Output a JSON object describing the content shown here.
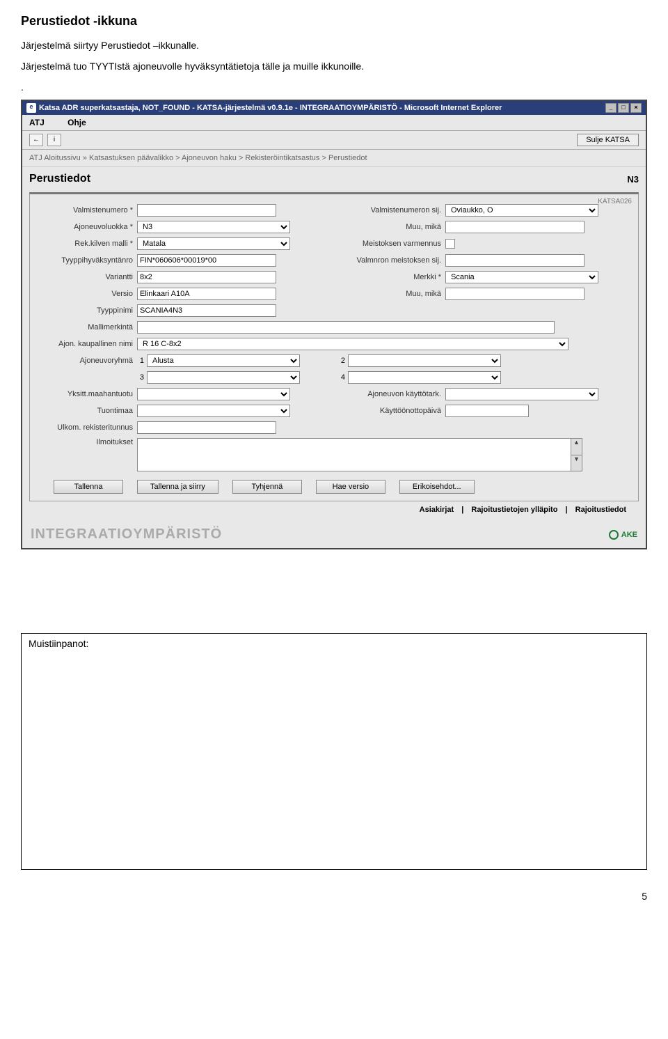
{
  "doc": {
    "heading": "Perustiedot -ikkuna",
    "intro1": "Järjestelmä siirtyy Perustiedot –ikkunalle.",
    "intro2": "Järjestelmä tuo TYYTIstä ajoneuvolle hyväksyntätietoja tälle ja muille ikkunoille.",
    "dot": ".",
    "notes_label": "Muistiinpanot:",
    "page_number": "5"
  },
  "window": {
    "title": "Katsa ADR superkatsastaja, NOT_FOUND - KATSA-järjestelmä v0.9.1e - INTEGRAATIOYMPÄRISTÖ - Microsoft Internet Explorer",
    "menu": {
      "atj": "ATJ",
      "ohje": "Ohje"
    },
    "sulje": "Sulje KATSA",
    "breadcrumb": "ATJ Aloitussivu » Katsastuksen päävalikko > Ajoneuvon haku > Rekisteröintikatsastus > Perustiedot",
    "page_title": "Perustiedot",
    "page_class": "N3",
    "katsa_code": "KATSA026",
    "env": "INTEGRAATIOYMPÄRISTÖ",
    "ake": "AKE"
  },
  "form": {
    "labels": {
      "valmistenumero": "Valmistenumero *",
      "valmistenumeron_sij": "Valmistenumeron sij.",
      "ajoneuvoluokka": "Ajoneuvoluokka *",
      "muu_mika_l": "Muu, mikä",
      "rekkilven_malli": "Rek.kilven malli *",
      "meistoksen_varmennus": "Meistoksen varmennus",
      "tyyppihyvaksyntanro": "Tyyppihyväksyntänro",
      "valmnron_meist_sij": "Valmnron meistoksen sij.",
      "variantti": "Variantti",
      "merkki": "Merkki *",
      "versio": "Versio",
      "muu_mika_r": "Muu, mikä",
      "tyyppinimi": "Tyyppinimi",
      "mallimerkinta": "Mallimerkintä",
      "ajon_kaup_nimi": "Ajon. kaupallinen nimi",
      "ajoneuvoryhma": "Ajoneuvoryhmä",
      "yksitt_maahantuotu": "Yksitt.maahantuotu",
      "ajoneuvon_kayttotark": "Ajoneuvon käyttötark.",
      "tuontimaa": "Tuontimaa",
      "kayttoonottopaiva": "Käyttöönottopäivä",
      "ulkom_rekisteritunnus": "Ulkom. rekisteritunnus",
      "ilmoitukset": "Ilmoitukset"
    },
    "values": {
      "valmistenumero": "",
      "valmistenumeron_sij": "Oviaukko, O",
      "ajoneuvoluokka": "N3",
      "muu_mika_l": "",
      "rekkilven_malli": "Matala",
      "tyyppihyvaksyntanro": "FIN*060606*00019*00",
      "valmnron_meist_sij": "",
      "variantti": "8x2",
      "merkki": "Scania",
      "versio": "Elinkaari A10A",
      "muu_mika_r": "",
      "tyyppinimi": "SCANIA4N3",
      "mallimerkinta": "",
      "ajon_kaup_nimi": "R 16 C-8x2",
      "ajoneuvoryhma1": "Alusta",
      "ajoneuvoryhma2": "",
      "ajoneuvoryhma3": "",
      "ajoneuvoryhma4": "",
      "yksitt_maahantuotu": "",
      "ajoneuvon_kayttotark": "",
      "tuontimaa": "",
      "kayttoonottopaiva": "",
      "ulkom_rekisteritunnus": "",
      "ilmoitukset": ""
    },
    "nums": {
      "n1": "1",
      "n2": "2",
      "n3": "3",
      "n4": "4"
    },
    "buttons": {
      "tallenna": "Tallenna",
      "tallenna_ja_siirry": "Tallenna ja siirry",
      "tyhjenna": "Tyhjennä",
      "hae_versio": "Hae versio",
      "erikoisehdot": "Erikoisehdot..."
    },
    "links": {
      "asiakirjat": "Asiakirjat",
      "rajoitustietojen_yllapito": "Rajoitustietojen ylläpito",
      "rajoitustiedot": "Rajoitustiedot",
      "sep": "|"
    }
  }
}
